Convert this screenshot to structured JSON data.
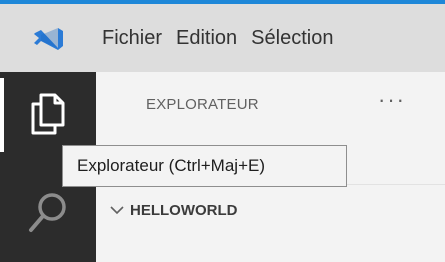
{
  "menubar": {
    "app_icon": "vscode-logo-icon",
    "items": [
      {
        "label": "Fichier"
      },
      {
        "label": "Edition"
      },
      {
        "label": "Sélection"
      }
    ]
  },
  "activitybar": {
    "items": [
      {
        "icon": "files-icon",
        "active": true
      },
      {
        "icon": "search-icon",
        "active": false
      }
    ]
  },
  "sidebar": {
    "title": "EXPLORATEUR",
    "more_actions": "···",
    "section": {
      "expanded_icon": "chevron-down-icon",
      "label": "HELLOWORLD"
    }
  },
  "tooltip": {
    "text": "Explorateur (Ctrl+Maj+E)"
  },
  "colors": {
    "accent": "#1e87d8",
    "menubar_bg": "#dddddd",
    "activitybar_bg": "#2c2c2c",
    "sidebar_bg": "#f3f3f3",
    "vscode_blue": "#2b7bd6"
  }
}
